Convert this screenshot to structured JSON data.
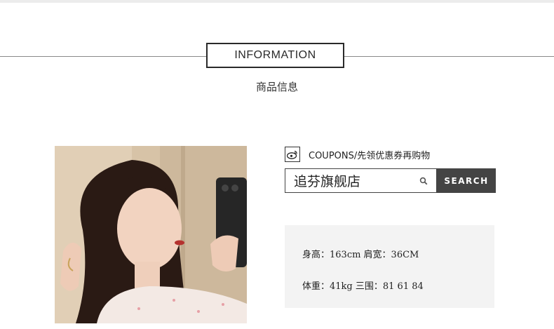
{
  "header": {
    "title": "INFORMATION",
    "subtitle": "商品信息"
  },
  "coupon": {
    "icon": "weibo-icon",
    "text": "COUPONS/先领优惠券再购物"
  },
  "search": {
    "value": "追芬旗舰店",
    "icon": "search-icon",
    "button_label": "SEARCH"
  },
  "model": {
    "line1": "身高：163cm  肩宽：36CM",
    "line2": "体重：41kg  三围：81 61 84"
  },
  "colors": {
    "button_bg": "#444444",
    "panel_bg": "#f3f3f3",
    "border": "#2a2a2a"
  }
}
